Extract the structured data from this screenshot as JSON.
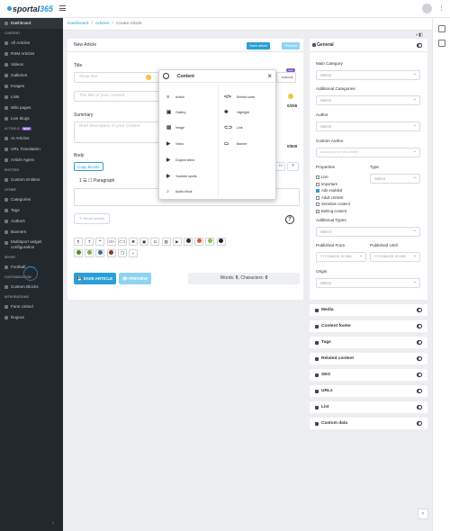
{
  "app": {
    "logo_prefix": "sportal",
    "logo_number": "365"
  },
  "breadcrumb": {
    "items": [
      "Dashboard",
      "Articles",
      "Create Article"
    ]
  },
  "sidebar": {
    "items": [
      {
        "type": "item",
        "label": "Dashboard",
        "active": true
      },
      {
        "type": "section",
        "label": "CONTENT"
      },
      {
        "type": "item",
        "label": "All Articles"
      },
      {
        "type": "item",
        "label": "RSM Articles"
      },
      {
        "type": "item",
        "label": "Videos"
      },
      {
        "type": "item",
        "label": "Galleries"
      },
      {
        "type": "item",
        "label": "Images"
      },
      {
        "type": "item",
        "label": "Lists"
      },
      {
        "type": "item",
        "label": "Wiki pages"
      },
      {
        "type": "item",
        "label": "Live blogs"
      },
      {
        "type": "section",
        "label": "AI TOOLS",
        "badge": "NEW"
      },
      {
        "type": "item",
        "label": "AI Articles"
      },
      {
        "type": "item",
        "label": "URL Translation"
      },
      {
        "type": "item",
        "label": "Article Agent"
      },
      {
        "type": "section",
        "label": "ENTITIES"
      },
      {
        "type": "item",
        "label": "Custom Entities"
      },
      {
        "type": "section",
        "label": "OTHER"
      },
      {
        "type": "item",
        "label": "Categories"
      },
      {
        "type": "item",
        "label": "Tags"
      },
      {
        "type": "item",
        "label": "Authors"
      },
      {
        "type": "item",
        "label": "Banners"
      },
      {
        "type": "item2",
        "label": "Multisport widget",
        "label2": "configuration"
      },
      {
        "type": "section",
        "label": "SPORT"
      },
      {
        "type": "item",
        "label": "Football"
      },
      {
        "type": "section",
        "label": "CUSTOMIZATION"
      },
      {
        "type": "item",
        "label": "Custom Blocks"
      },
      {
        "type": "section",
        "label": "INTEGRATIONS"
      },
      {
        "type": "item",
        "label": "Fans United"
      },
      {
        "type": "item",
        "label": "Dugout"
      }
    ]
  },
  "editor": {
    "header_title": "New Article",
    "save_small": "Save article",
    "preview_small": "Preview",
    "title_label": "Title",
    "strap_placeholder": "Strap line",
    "title_placeholder": "The title of your content",
    "title_counter": "0/255",
    "new_badge": "new",
    "suggestions_label": "estions",
    "summary_label": "Summary",
    "summary_placeholder": "Brief description of your content",
    "summary_counter": "0/500",
    "body_label": "Body",
    "copy_blocks": "Copy blocks",
    "dropdown_fragment": "m.",
    "paragraph_label": "Paragraph",
    "paragraph_index": "1",
    "smart_search": "Smart search",
    "save_button": "SAVE ARTICLE",
    "preview_button": "PREVIEW",
    "words_label": "Words: ",
    "words_value": "0",
    "chars_label": ", Characters: ",
    "chars_value": "0"
  },
  "popup": {
    "title": "Content",
    "left": [
      {
        "label": "Article",
        "icon": "≡"
      },
      {
        "label": "Gallery",
        "icon": "▣"
      },
      {
        "label": "Image",
        "icon": "▨"
      },
      {
        "label": "Video",
        "icon": "▶"
      },
      {
        "label": "Dugout video",
        "icon": "▶"
      },
      {
        "label": "Youtube sports",
        "icon": "▶"
      },
      {
        "label": "Audio block",
        "icon": "♪"
      }
    ],
    "right": [
      {
        "label": "Embed code",
        "icon": "</>"
      },
      {
        "label": "Highlight",
        "icon": "✱"
      },
      {
        "label": "Link",
        "icon": "⊂⊃"
      },
      {
        "label": "Banner",
        "icon": "▭"
      }
    ]
  },
  "toolbar_icons": [
    {
      "name": "paragraph",
      "glyph": "¶"
    },
    {
      "name": "heading",
      "glyph": "T"
    },
    {
      "name": "quote",
      "glyph": "❝"
    },
    {
      "name": "code",
      "glyph": "</>"
    },
    {
      "name": "link",
      "glyph": "⊂⊃"
    },
    {
      "name": "highlight",
      "glyph": "✱"
    },
    {
      "name": "gallery",
      "glyph": "▣"
    },
    {
      "name": "camera",
      "glyph": "◘"
    },
    {
      "name": "image",
      "glyph": "▨"
    },
    {
      "name": "video",
      "glyph": "▶"
    },
    {
      "name": "football",
      "glyph": "●",
      "color": "#333"
    },
    {
      "name": "football-alt",
      "glyph": "●",
      "color": "#e05a2a"
    },
    {
      "name": "tennis",
      "glyph": "●",
      "color": "#8bc34a"
    },
    {
      "name": "rugby",
      "glyph": "●",
      "color": "#222"
    },
    {
      "name": "basketball",
      "glyph": "●",
      "color": "#5a8a2a"
    },
    {
      "name": "tennis-ball",
      "glyph": "●",
      "color": "#7cb342"
    },
    {
      "name": "volleyball",
      "glyph": "●",
      "color": "#3f6aa0"
    },
    {
      "name": "american-football",
      "glyph": "●",
      "color": "#8b3a1a"
    },
    {
      "name": "copy",
      "glyph": "❐"
    },
    {
      "name": "add",
      "glyph": "+"
    }
  ],
  "general": {
    "title": "General",
    "main_category_label": "Main Category",
    "main_category_value": "Select",
    "additional_categories_label": "Additional Categories",
    "additional_categories_value": "Select",
    "author_label": "Author",
    "author_value": "Select",
    "custom_author_label": "Custom Author",
    "custom_author_placeholder": "Author just for this content",
    "properties_label": "Properties",
    "properties": [
      {
        "label": "Live",
        "checked": false
      },
      {
        "label": "Important",
        "checked": false
      },
      {
        "label": "Ads enabled",
        "checked": true
      },
      {
        "label": "Adult content",
        "checked": false
      },
      {
        "label": "Sensitive content",
        "checked": false
      },
      {
        "label": "Betting content",
        "checked": false
      }
    ],
    "type_label": "Type",
    "type_value": "Select",
    "additional_types_label": "Additional Types",
    "additional_types_value": "Select",
    "published_from_label": "Published From",
    "published_from_placeholder": "YYYY.MM.DD. HH:MM",
    "published_until_label": "Published Until",
    "published_until_placeholder": "YYYY.MM.DD. HH:MM",
    "origin_label": "Origin",
    "origin_value": "Select"
  },
  "collapsibles": [
    "Media",
    "Content footer",
    "Tags",
    "Related content",
    "SEO",
    "URLs",
    "List",
    "Custom data"
  ],
  "colors": {
    "accent": "#2a9fd6",
    "sidebar": "#23282d",
    "accent_light": "#8fd3f2"
  }
}
